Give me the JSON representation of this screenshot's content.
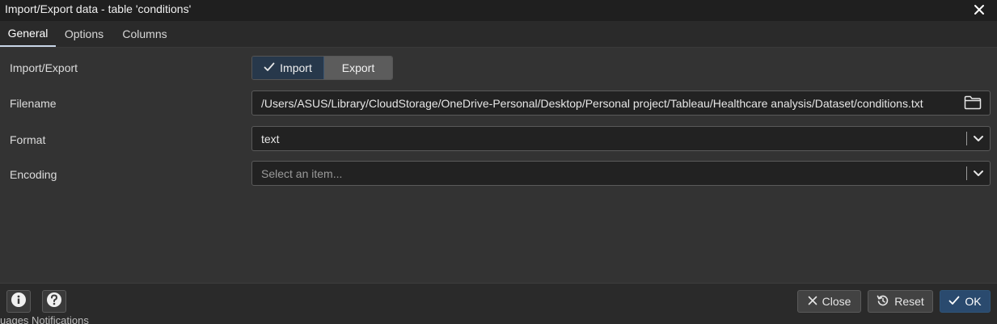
{
  "window": {
    "title": "Import/Export data - table 'conditions'"
  },
  "tabs": [
    {
      "label": "General",
      "active": true
    },
    {
      "label": "Options",
      "active": false
    },
    {
      "label": "Columns",
      "active": false
    }
  ],
  "form": {
    "import_export": {
      "label": "Import/Export",
      "options": [
        "Import",
        "Export"
      ],
      "selected": "Import"
    },
    "filename": {
      "label": "Filename",
      "value": "/Users/ASUS/Library/CloudStorage/OneDrive-Personal/Desktop/Personal project/Tableau/Healthcare analysis/Dataset/conditions.txt",
      "icon": "folder-icon"
    },
    "format": {
      "label": "Format",
      "value": "text"
    },
    "encoding": {
      "label": "Encoding",
      "value": "",
      "placeholder": "Select an item..."
    }
  },
  "footer": {
    "info_icon": "info-icon",
    "help_icon": "help-icon",
    "close_label": "Close",
    "reset_label": "Reset",
    "ok_label": "OK"
  },
  "background_text": "uages   Notifications",
  "colors": {
    "titlebar": "#1f1f1f",
    "body": "#333333",
    "primary_button": "#2a4a6e",
    "selected_segment": "#27384b",
    "field_bg": "#222222"
  }
}
